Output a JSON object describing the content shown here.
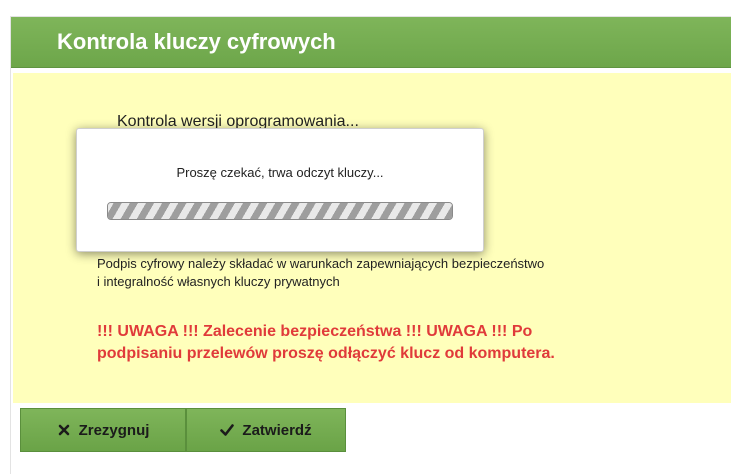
{
  "dialog": {
    "title": "Kontrola kluczy cyfrowych"
  },
  "content": {
    "version_check": "Kontrola wersji oprogramowania...",
    "info_text_line1": "Podpis cyfrowy należy składać w warunkach zapewniających bezpieczeństwo",
    "info_text_line2": "i integralność własnych kluczy prywatnych",
    "warning_line1": "!!! UWAGA !!! Zalecenie bezpieczeństwa !!! UWAGA !!! Po",
    "warning_line2": "podpisaniu przelewów proszę odłączyć klucz od komputera."
  },
  "modal": {
    "message": "Proszę czekać, trwa odczyt kluczy...",
    "progress": 1.0
  },
  "buttons": {
    "cancel_label": "Zrezygnuj",
    "cancel_icon": "close-icon",
    "confirm_label": "Zatwierdź",
    "confirm_icon": "check-icon"
  },
  "colors": {
    "accent": "#6da64a",
    "content_bg": "#ffffbb",
    "warning": "#e03a3a"
  }
}
